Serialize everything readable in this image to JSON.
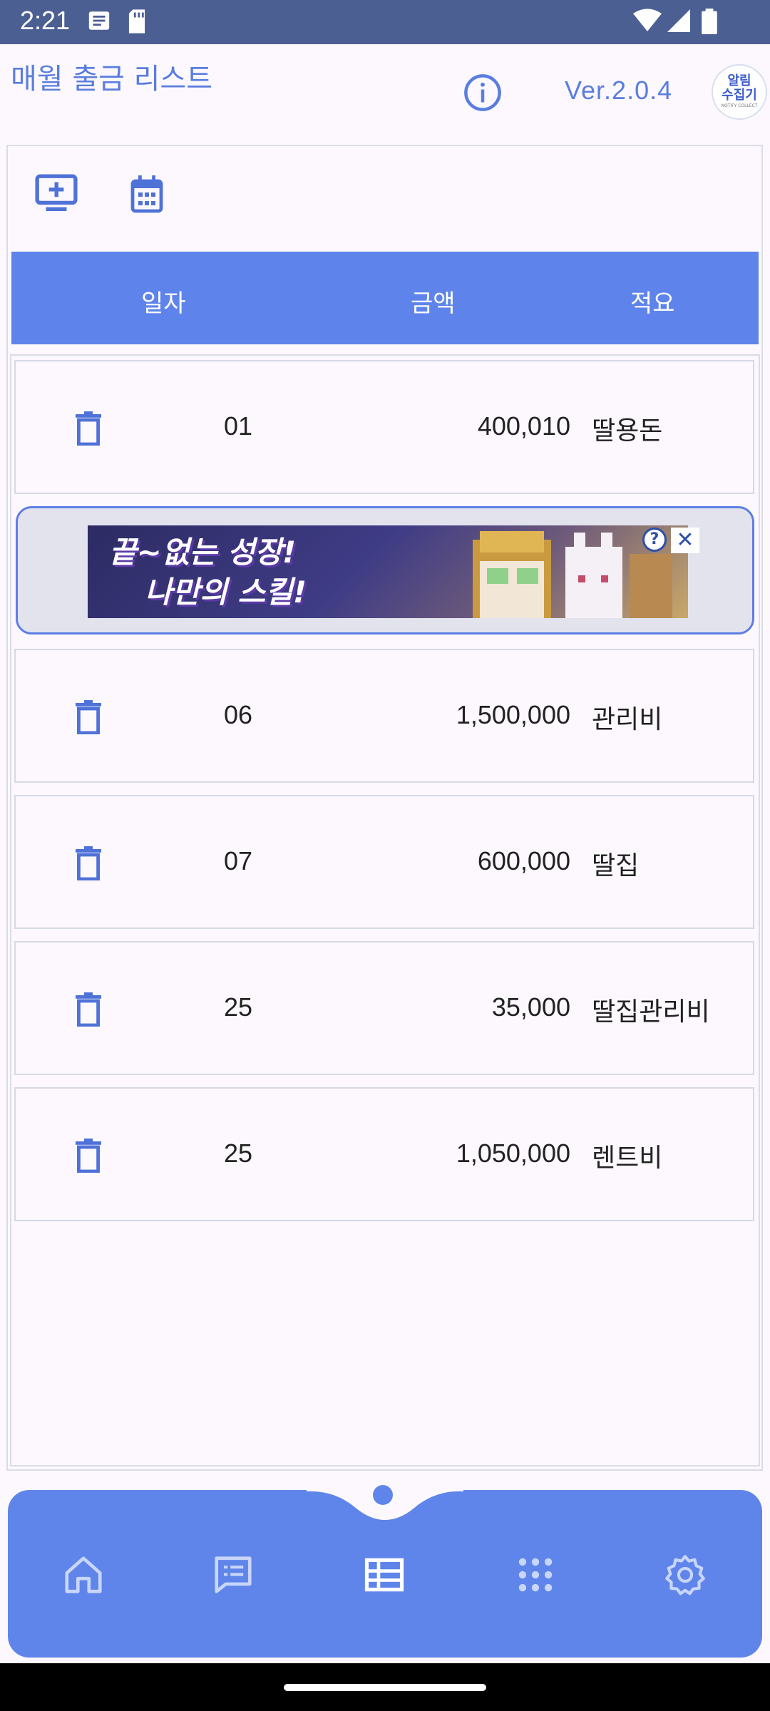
{
  "status_bar": {
    "time": "2:21"
  },
  "header": {
    "title": "매월 출금 리스트",
    "version": "Ver.2.0.4",
    "logo_text": [
      "알림",
      "수집기",
      "NOTIFY COLLECT"
    ]
  },
  "table": {
    "columns": [
      "일자",
      "금액",
      "적요"
    ],
    "rows": [
      {
        "day": "01",
        "amount": "400,010",
        "memo": "딸용돈"
      },
      {
        "day": "06",
        "amount": "1,500,000",
        "memo": "관리비"
      },
      {
        "day": "07",
        "amount": "600,000",
        "memo": "딸집"
      },
      {
        "day": "25",
        "amount": "35,000",
        "memo": "딸집관리비"
      },
      {
        "day": "25",
        "amount": "1,050,000",
        "memo": "렌트비"
      }
    ]
  },
  "ad": {
    "line1": "끝~없는 성장!",
    "line2": "나만의 스킬!",
    "help": "?",
    "close": "✕"
  },
  "nav": {
    "active": "list",
    "items": [
      "home",
      "messages",
      "list",
      "apps",
      "settings"
    ]
  },
  "colors": {
    "accent": "#5e84ec",
    "status_bar": "#4c5f93",
    "title": "#5a7ddf"
  }
}
